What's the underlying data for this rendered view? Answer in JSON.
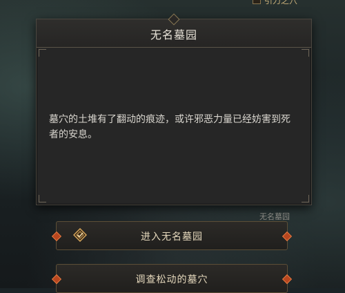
{
  "top_checkbox_label": "引力之穴",
  "dialog": {
    "title": "无名墓园",
    "body": "墓穴的土堆有了翻动的痕迹，或许邪恶力量已经妨害到死者的安息。",
    "location_label": "无名墓园"
  },
  "options": [
    {
      "label": "进入无名墓园",
      "icon": "selected-diamond-check-icon"
    },
    {
      "label": "调查松动的墓穴"
    }
  ],
  "colors": {
    "accent_orange": "#b8461f",
    "gold": "#c9b07a",
    "panel": "#262626"
  }
}
